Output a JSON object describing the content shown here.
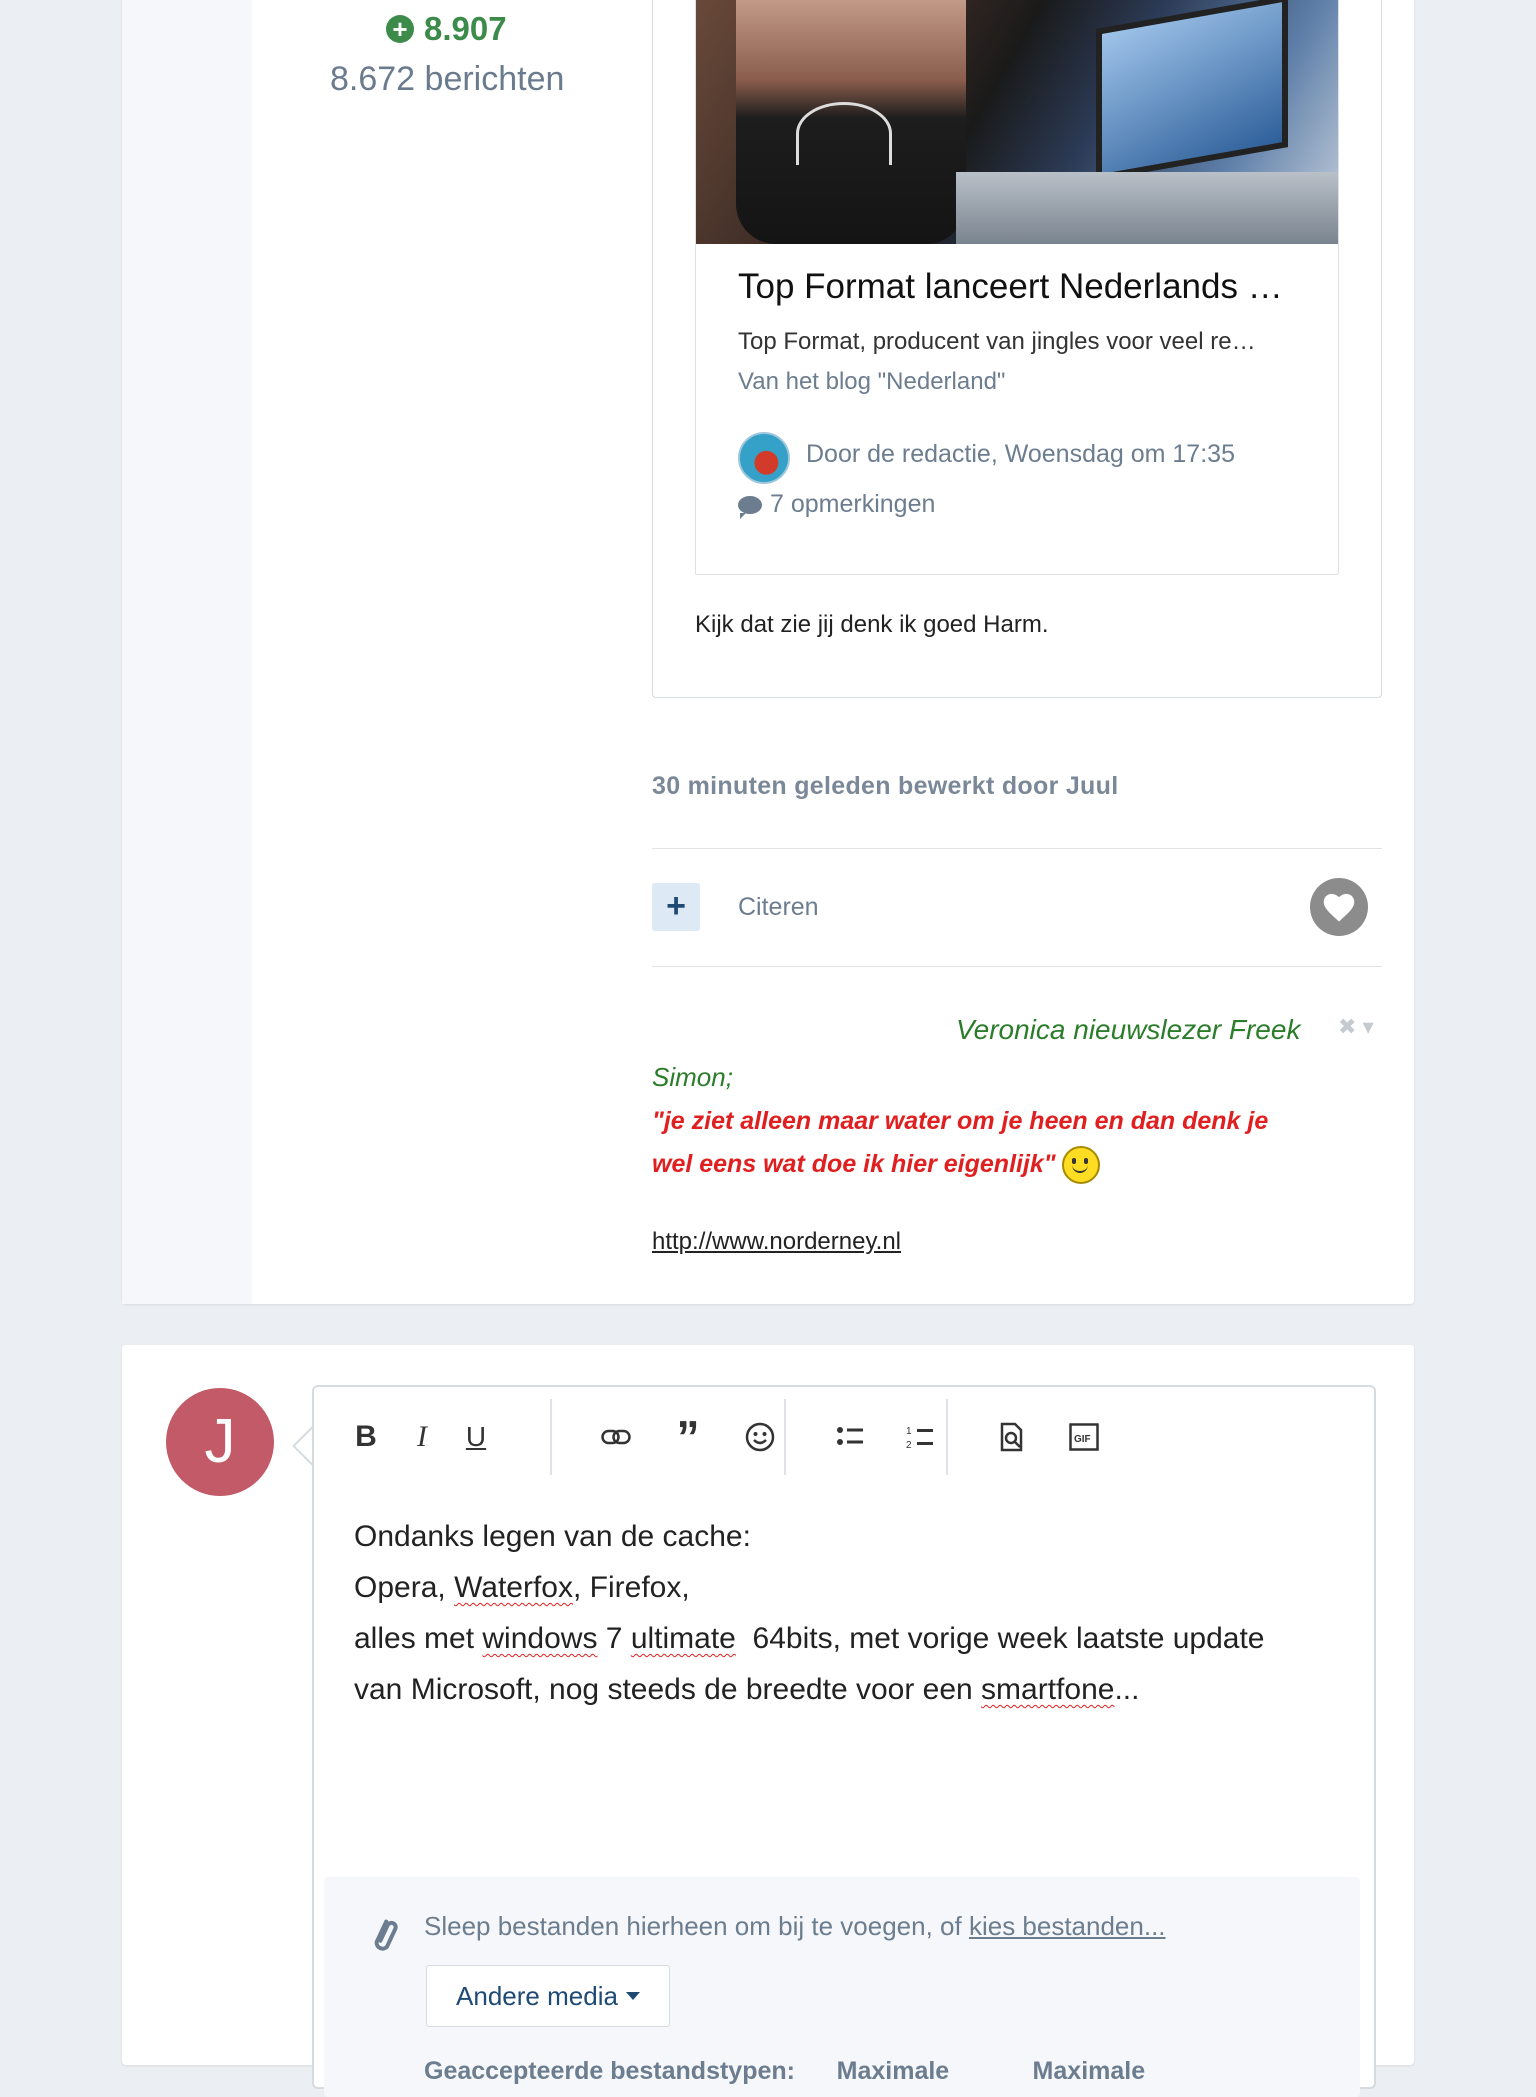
{
  "author": {
    "reputation": "8.907",
    "message_count": "8.672 berichten"
  },
  "embed": {
    "title": "Top Format lanceert Nederlands …",
    "description": "Top Format, producent van jingles voor veel re…",
    "source": "Van het blog \"Nederland\"",
    "byline": "Door de redactie, Woensdag om 17:35",
    "comments": "7 opmerkingen"
  },
  "quote_text": "Kijk dat zie jij denk ik goed Harm.",
  "edited_note": "30 minuten geleden bewerkt door Juul",
  "actions": {
    "multiquote_label": "+",
    "quote_label": "Citeren"
  },
  "signature": {
    "name": "Veronica nieuwslezer Freek",
    "simon": "Simon;",
    "quote_line1": "\"je ziet alleen maar water om je heen en dan denk je",
    "quote_line2": "wel eens wat doe ik hier eigenlijk\"",
    "link": "http://www.norderney.nl"
  },
  "reply": {
    "avatar_letter": "J",
    "line1": "Ondanks legen van de cache:",
    "line2_a": "Opera, ",
    "line2_b": "Waterfox",
    "line2_c": ", Firefox,",
    "line3_a": "alles met ",
    "line3_b": "windows",
    "line3_c": " 7 ",
    "line3_d": "ultimate",
    "line3_e": "  64bits, met vorige week laatste update",
    "line4_a": "van Microsoft, nog steeds de breedte voor een ",
    "line4_b": "smartfone",
    "line4_c": "...",
    "drop_text": "Sleep bestanden hierheen om bij te voegen, of ",
    "drop_link": "kies bestanden...",
    "media_button": "Andere media",
    "accepted_types": "Geaccepteerde bestandstypen:      Maximale            Maximale"
  },
  "toolbar_icons": [
    "bold-icon",
    "italic-icon",
    "underline-icon",
    "link-icon",
    "quote-icon",
    "emoji-icon",
    "bullet-list-icon",
    "numbered-list-icon",
    "preview-icon",
    "gif-icon"
  ],
  "colors": {
    "reputation_green": "#3d8b4a",
    "signature_green": "#2b7d2b",
    "signature_red": "#e02020",
    "avatar_bg": "#c25a67",
    "link_blue": "#1f4a74"
  }
}
